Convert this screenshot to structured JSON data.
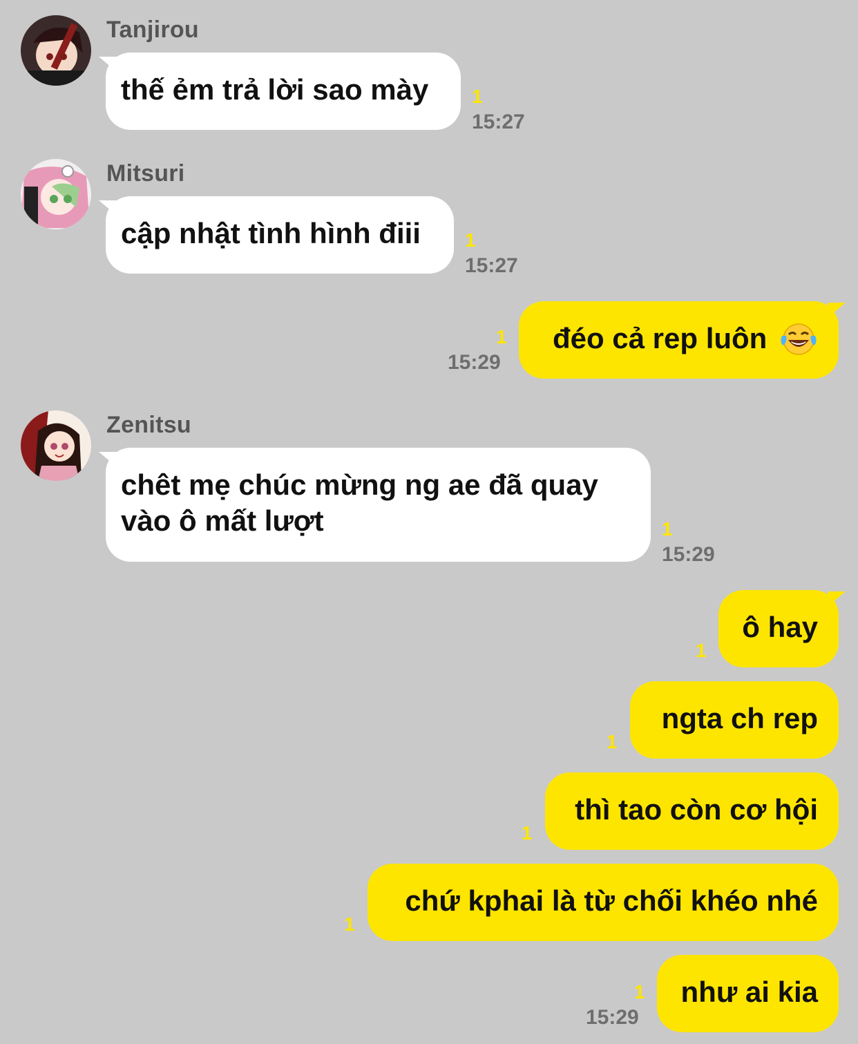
{
  "messages": [
    {
      "sender": "Tanjirou",
      "text": "thế ẻm trả lời sao mày",
      "unread": "1",
      "time": "15:27"
    },
    {
      "sender": "Mitsuri",
      "text": "cập nhật tình hình điii",
      "unread": "1",
      "time": "15:27"
    },
    {
      "sender": "me",
      "text": "đéo cả rep luôn",
      "emoji": "laughing-tears-emoji",
      "unread": "1",
      "time": "15:29"
    },
    {
      "sender": "Zenitsu",
      "text_line1": "chêt mẹ chúc mừng ng ae đã quay",
      "text_line2": "vào ô mất lượt",
      "unread": "1",
      "time": "15:29"
    },
    {
      "sender": "me",
      "text": "ô hay",
      "unread": "1"
    },
    {
      "sender": "me",
      "text": "ngta ch rep",
      "unread": "1"
    },
    {
      "sender": "me",
      "text": "thì tao còn cơ hội",
      "unread": "1"
    },
    {
      "sender": "me",
      "text": "chứ kphai là từ chối khéo nhé",
      "unread": "1"
    },
    {
      "sender": "me",
      "text": "như ai kia",
      "unread": "1",
      "time": "15:29"
    }
  ],
  "colors": {
    "background": "#c9c9c9",
    "incoming_bubble": "#ffffff",
    "outgoing_bubble": "#fee500",
    "unread_count": "#fee500",
    "timestamp": "#6e6e6e",
    "sender_name": "#555555"
  }
}
